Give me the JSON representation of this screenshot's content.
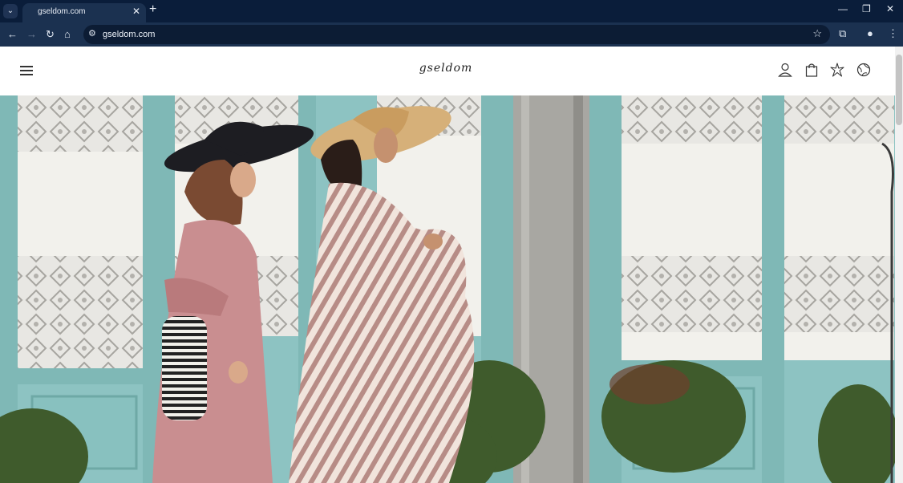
{
  "browser": {
    "tab_title": "gseldom.com",
    "url": "gseldom.com"
  },
  "site": {
    "logo": "gseldom"
  },
  "icons": {
    "menu": "hamburger-menu-icon",
    "account": "user-icon",
    "bag": "shopping-bag-icon",
    "wishlist": "starfish-icon",
    "region": "globe-icon"
  },
  "colors": {
    "chrome_dark": "#0a1d3a",
    "chrome_toolbar": "#1b3150",
    "accent_teal": "#8dc3c2"
  }
}
